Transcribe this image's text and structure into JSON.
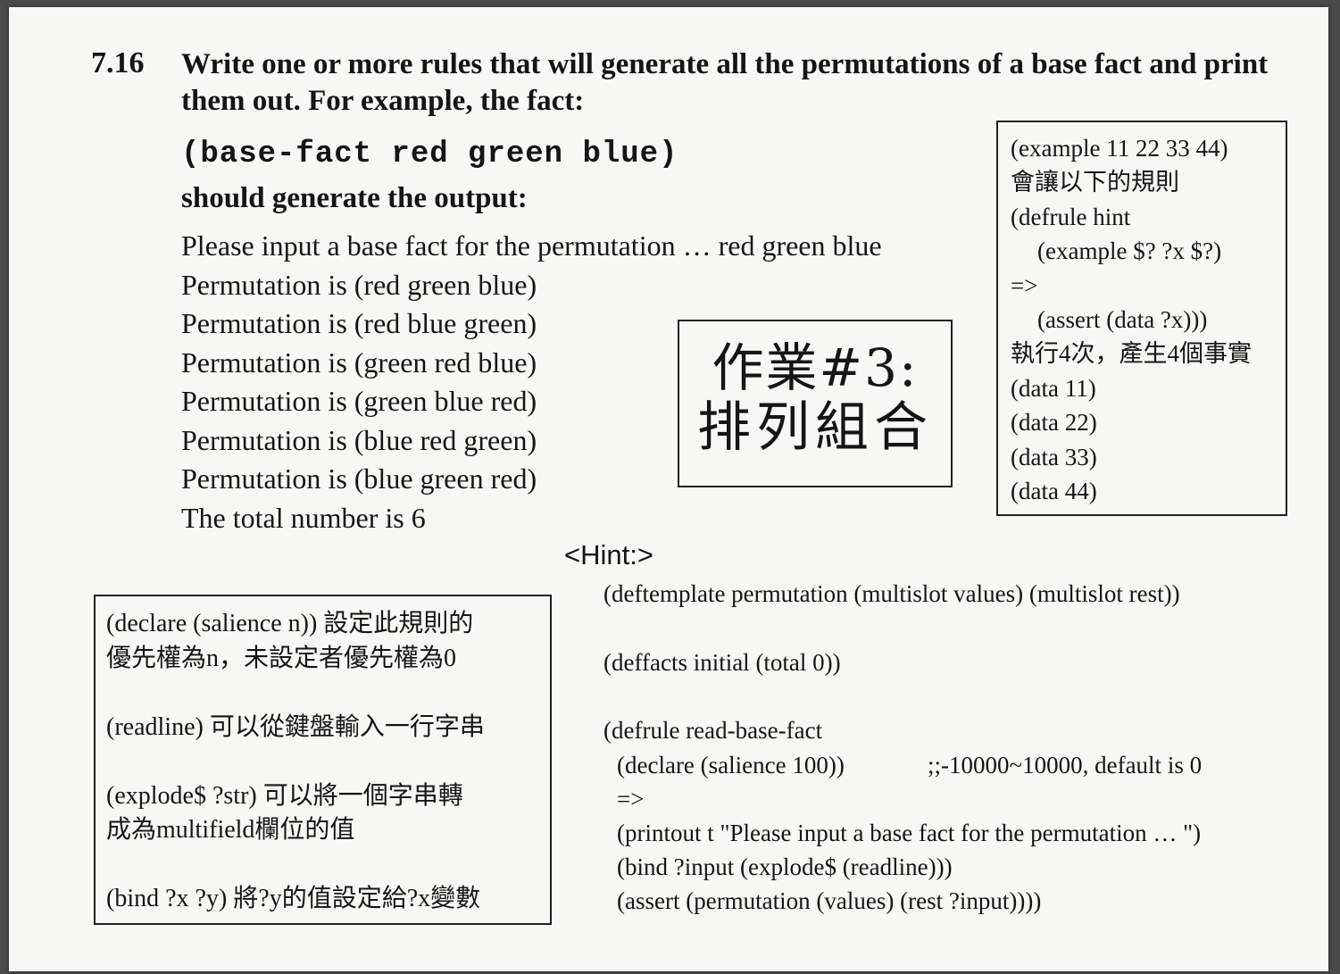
{
  "problem": {
    "number": "7.16",
    "statement": "Write one or more rules that will generate all the permutations of a base fact and print them out. For example, the fact:",
    "fact_code": "(base-fact red green blue)",
    "output_intro": "should generate the output:",
    "output_lines": [
      "Please input a base fact for the permutation …  red green blue",
      "Permutation is (red green blue)",
      "Permutation is (red blue green)",
      "Permutation is (green red blue)",
      "Permutation is (green blue red)",
      "Permutation is (blue red green)",
      "Permutation is (blue green red)",
      "The total number is 6"
    ]
  },
  "homework": {
    "title": "作業#3:",
    "subtitle": "排列組合"
  },
  "example_box": {
    "lines": [
      "(example 11 22 33 44)",
      "會讓以下的規則",
      "(defrule hint",
      "(example $? ?x $?)",
      "=>",
      "(assert (data ?x)))",
      "執行4次，產生4個事實",
      "(data 11)",
      "(data 22)",
      "(data 33)",
      "(data 44)"
    ]
  },
  "hint": {
    "label": "<Hint:>",
    "code": {
      "deftemplate": "(deftemplate permutation (multislot values) (multislot rest))",
      "deffacts": "(deffacts initial  (total 0))",
      "defrule": "(defrule read-base-fact",
      "declare": "(declare (salience 100))",
      "comment": ";;-10000~10000, default is 0",
      "arrow": "=>",
      "printout": "(printout t \"Please input a base fact for the permutation … \")",
      "bind": "(bind ?input (explode$ (readline)))",
      "assert": "(assert (permutation (values) (rest ?input))))"
    }
  },
  "notes_box": {
    "declare_line1": "(declare (salience n)) 設定此規則的",
    "declare_line2": "優先權為n，未設定者優先權為0",
    "readline": "(readline) 可以從鍵盤輸入一行字串",
    "explode_line1": "(explode$  ?str)  可以將一個字串轉",
    "explode_line2": "成為multifield欄位的值",
    "bind": "(bind ?x ?y) 將?y的值設定給?x變數"
  }
}
